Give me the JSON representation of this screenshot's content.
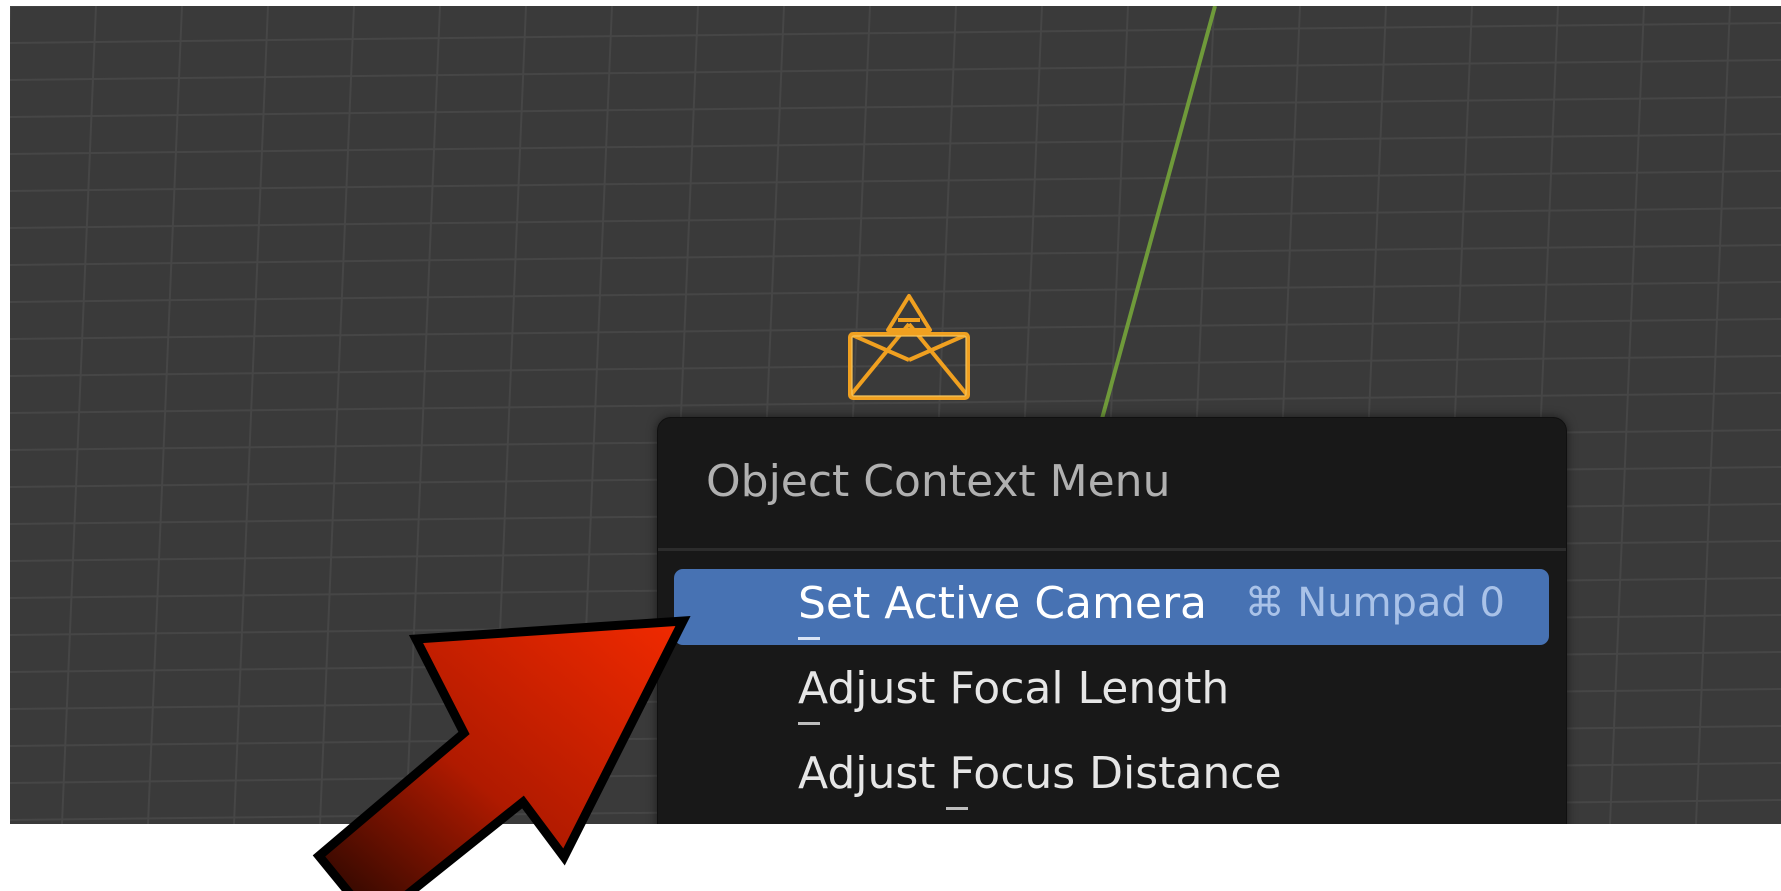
{
  "viewport": {
    "background_color": "#3a3a3a",
    "grid_color": "#464646",
    "y_axis_color": "#6f9a3a"
  },
  "camera": {
    "icon": "camera-icon",
    "color": "#f0a020"
  },
  "context_menu": {
    "title": "Object Context Menu",
    "items": [
      {
        "label": "Set Active Camera",
        "shortcut": "⌘ Numpad 0",
        "highlighted": true
      },
      {
        "label": "Adjust Focal Length",
        "shortcut": "",
        "highlighted": false
      },
      {
        "label": "Adjust Focus Distance",
        "shortcut": "",
        "highlighted": false
      }
    ],
    "highlight_color": "#4772b3"
  },
  "annotation": {
    "icon": "pointer-arrow-icon",
    "color": "#e82a0c"
  }
}
